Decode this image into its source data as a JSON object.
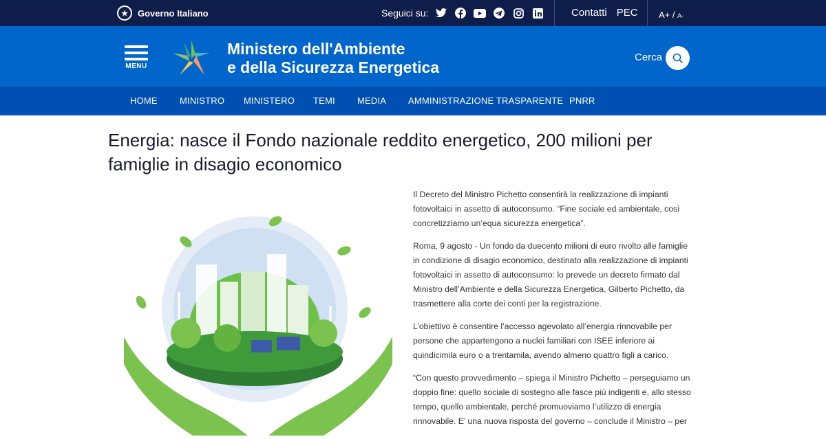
{
  "topbar": {
    "gov_label": "Governo Italiano",
    "follow_label": "Seguici su:",
    "social": [
      "twitter-icon",
      "facebook-icon",
      "youtube-icon",
      "telegram-icon",
      "instagram-icon",
      "linkedin-icon"
    ],
    "contatti": "Contatti",
    "pec": "PEC",
    "font_large": "A+",
    "font_slash": " / ",
    "font_small": "A-"
  },
  "header": {
    "menu_label": "MENU",
    "title_line1": "Ministero dell'Ambiente",
    "title_line2": "e della Sicurezza Energetica",
    "search_label": "Cerca"
  },
  "nav": {
    "items": [
      "HOME",
      "MINISTRO",
      "MINISTERO",
      "TEMI",
      "MEDIA",
      "AMMINISTRAZIONE TRASPARENTE",
      "PNRR"
    ]
  },
  "article": {
    "title": "Energia: nasce il Fondo nazionale reddito energetico, 200 milioni per famiglie in disagio economico",
    "paragraphs": [
      "Il Decreto del Ministro Pichetto consentirà la realizzazione di impianti fotovoltaici in assetto di autoconsumo. “Fine sociale ed ambientale, così concretizziamo un’equa sicurezza energetica”.",
      "Roma, 9 agosto - Un fondo da duecento milioni di euro rivolto alle famiglie in condizione di disagio economico, destinato alla realizzazione di impianti fotovoltaici in assetto di autoconsumo: lo prevede un decreto firmato dal Ministro dell’Ambiente e della Sicurezza Energetica, Gilberto Pichetto, da trasmettere alla corte dei conti per la registrazione.",
      "L’obiettivo è consentire l’accesso agevolato all’energia rinnovabile per persone che appartengono a nuclei familiari con ISEE inferiore ai quindicimila euro o a trentamila, avendo almeno quattro figli a carico.",
      "“Con questo provvedimento – spiega il Ministro Pichetto – perseguiamo un doppio fine: quello sociale di sostegno alle fasce più indigenti e, allo stesso tempo, quello ambientale, perché promuoviamo l’utilizzo di energia rinnovabile. E’ una nuova risposta del governo – conclude il Ministro – per"
    ]
  },
  "colors": {
    "topbar": "#0f1d4a",
    "header": "#0066cc",
    "nav": "#0050b3"
  }
}
